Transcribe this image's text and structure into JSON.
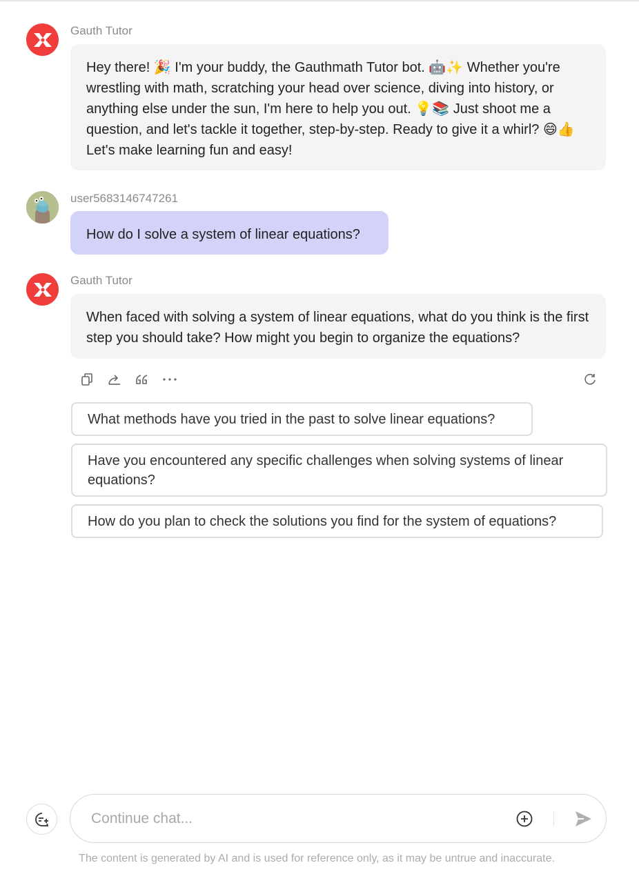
{
  "messages": [
    {
      "sender": "Gauth Tutor",
      "text": "Hey there! 🎉 I'm your buddy, the Gauthmath Tutor bot. 🤖✨ Whether you're wrestling with math, scratching your head over science, diving into history, or anything else under the sun, I'm here to help you out. 💡📚 Just shoot me a question, and let's tackle it together, step-by-step. Ready to give it a whirl? 😄👍 Let's make learning fun and easy!"
    },
    {
      "sender": "user5683146747261",
      "text": "How do I solve a system of linear equations?"
    },
    {
      "sender": "Gauth Tutor",
      "text": "When faced with solving a system of linear equations, what do you think is the first step you should take? How might you begin to organize the equations?"
    }
  ],
  "actions": {
    "icons": [
      "copy-icon",
      "share-icon",
      "quote-icon",
      "more-icon",
      "refresh-icon"
    ]
  },
  "suggestions": [
    "What methods have you tried in the past to solve linear equations?",
    "Have you encountered any specific challenges when solving systems of linear equations?",
    "How do you plan to check the solutions you find for the system of equations?"
  ],
  "input": {
    "placeholder": "Continue chat...",
    "value": ""
  },
  "disclaimer": "The content is generated by AI and is used for reference only, as it may be untrue and inaccurate.",
  "colors": {
    "brand_red": "#ee3d3a",
    "user_bubble": "#d3d3f9",
    "bot_bubble": "#f4f4f4"
  }
}
